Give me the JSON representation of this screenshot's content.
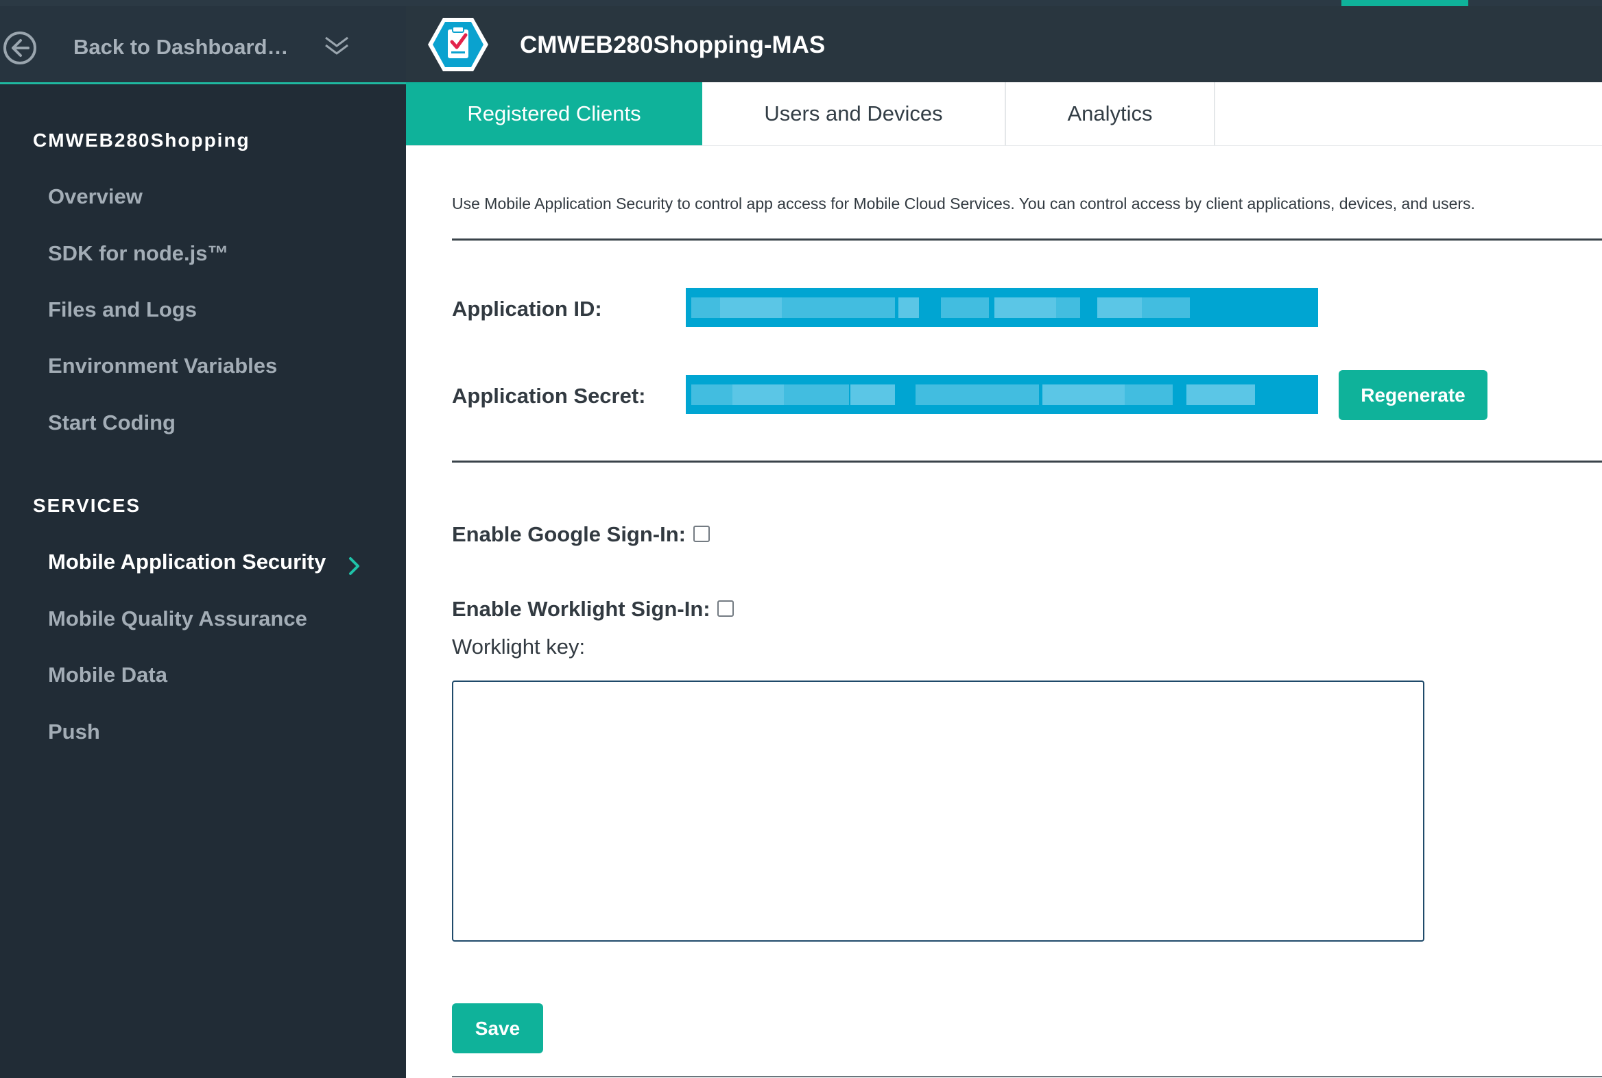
{
  "colors": {
    "sidebar_bg": "#212c36",
    "header_bg": "#29363f",
    "accent": "#0fb29a",
    "field_bg": "#00a5d2"
  },
  "sidebar": {
    "back_label": "Back to Dashboard…",
    "back_icon": "arrow-left-circle-icon",
    "collapse_icon": "double-chevron-down-icon",
    "app_section_title": "CMWEB280Shopping",
    "app_items": [
      {
        "label": "Overview"
      },
      {
        "label": "SDK for node.js™"
      },
      {
        "label": "Files and Logs"
      },
      {
        "label": "Environment Variables"
      },
      {
        "label": "Start Coding"
      }
    ],
    "services_title": "SERVICES",
    "service_items": [
      {
        "label": "Mobile Application Security",
        "active": true
      },
      {
        "label": "Mobile Quality Assurance"
      },
      {
        "label": "Mobile Data"
      },
      {
        "label": "Push"
      }
    ]
  },
  "header": {
    "logo_icon": "security-checklist-hexagon-icon",
    "title": "CMWEB280Shopping-MAS"
  },
  "tabs": [
    {
      "label": "Registered Clients",
      "active": true
    },
    {
      "label": "Users and Devices"
    },
    {
      "label": "Analytics"
    }
  ],
  "main": {
    "intro": "Use Mobile Application Security to control app access for Mobile Cloud Services.  You can control access by client applications, devices, and users.",
    "app_id_label": "Application ID:",
    "app_secret_label": "Application Secret:",
    "regenerate_label": "Regenerate",
    "google_signin_label": "Enable Google Sign-In:",
    "google_signin_checked": false,
    "worklight_signin_label": "Enable Worklight Sign-In:",
    "worklight_signin_checked": false,
    "worklight_key_label": "Worklight key:",
    "worklight_key_value": "",
    "save_label": "Save"
  }
}
